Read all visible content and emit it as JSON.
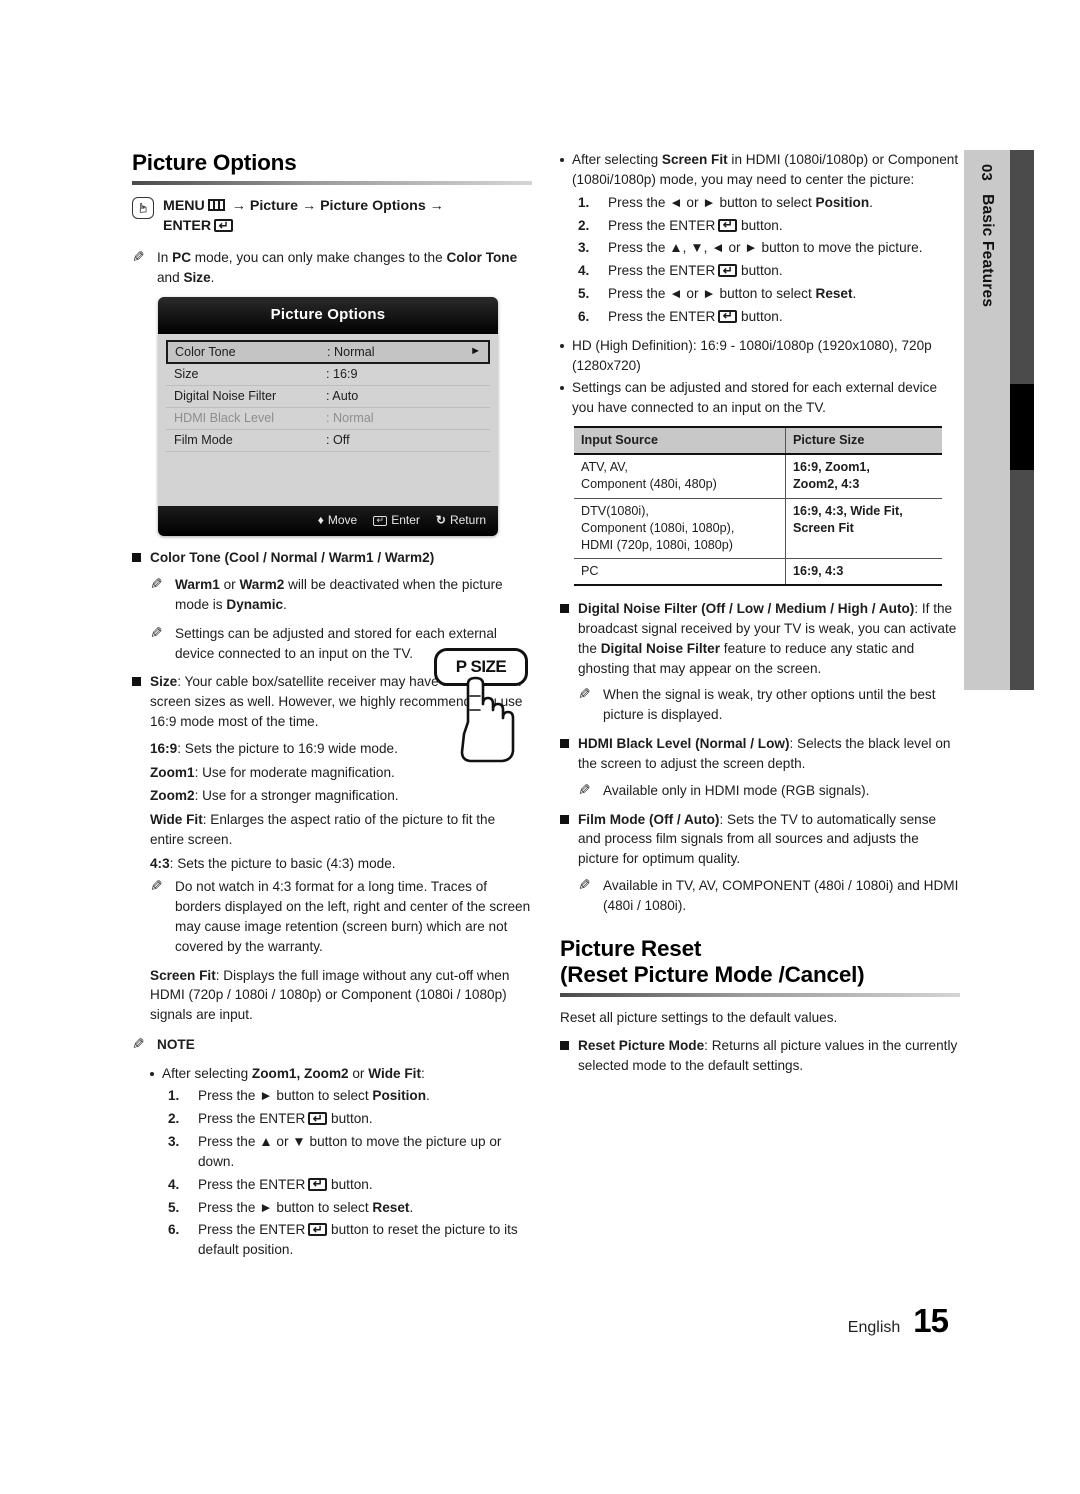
{
  "sidebar": {
    "chapter_number": "03",
    "chapter_title": "Basic Features"
  },
  "footer": {
    "language": "English",
    "page_number": "15"
  },
  "left_column": {
    "heading": "Picture Options",
    "menu_path": "MENU m → Picture → Picture Options → ENTER E",
    "menu_path_parts": {
      "menu_label": "MENU",
      "arrow1": "→",
      "picture": "Picture",
      "arrow2": "→",
      "picture_options": "Picture Options",
      "arrow3": "→",
      "enter_label": "ENTER"
    },
    "note_pc_mode": "In PC mode, you can only make changes to the Color Tone and Size.",
    "osd": {
      "title": "Picture Options",
      "rows": [
        {
          "label": "Color Tone",
          "value": ": Normal",
          "selected": true,
          "dim": false,
          "arrow": "►"
        },
        {
          "label": "Size",
          "value": ": 16:9",
          "selected": false,
          "dim": false,
          "arrow": ""
        },
        {
          "label": "Digital Noise Filter",
          "value": ": Auto",
          "selected": false,
          "dim": false,
          "arrow": ""
        },
        {
          "label": "HDMI Black Level",
          "value": ": Normal",
          "selected": false,
          "dim": true,
          "arrow": ""
        },
        {
          "label": "Film Mode",
          "value": ": Off",
          "selected": false,
          "dim": false,
          "arrow": ""
        }
      ],
      "footer": {
        "move": "Move",
        "enter": "Enter",
        "return": "Return",
        "move_glyph": "♦",
        "return_glyph": "↻"
      }
    },
    "color_tone_heading": "Color Tone (Cool / Normal / Warm1 / Warm2)",
    "color_tone_note1": "Warm1 or Warm2 will be deactivated when the picture mode is Dynamic.",
    "color_tone_note2": "Settings can be adjusted and stored for each external device connected to an input on the TV.",
    "size_heading": "Size",
    "size_text": ": Your cable box/satellite receiver may have its own set of screen sizes as well. However, we highly recommend you use 16:9 mode most of the time.",
    "psize_button_label": "P SIZE",
    "size_items": [
      {
        "term": "16:9",
        "desc": ": Sets the picture to 16:9 wide mode."
      },
      {
        "term": "Zoom1",
        "desc": ": Use for moderate magnification."
      },
      {
        "term": "Zoom2",
        "desc": ": Use for a stronger magnification."
      },
      {
        "term": "Wide Fit",
        "desc": ": Enlarges the aspect ratio of the picture to fit the entire screen."
      },
      {
        "term": "4:3",
        "desc": ": Sets the picture to basic (4:3) mode."
      }
    ],
    "four_three_note": "Do not watch in 4:3 format for a long time. Traces of borders displayed on the left, right and center of the screen may cause image retention (screen burn) which are not covered by the warranty.",
    "screen_fit_term": "Screen Fit",
    "screen_fit_desc": ": Displays the full image without any cut-off when HDMI (720p / 1080i / 1080p) or Component (1080i / 1080p) signals are input.",
    "note_label": "NOTE",
    "note_intro": "After selecting Zoom1, Zoom2 or Wide Fit:",
    "note_steps": [
      {
        "idx": "1.",
        "text": "Press the ► button to select Position."
      },
      {
        "idx": "2.",
        "text": "Press the ENTER E button."
      },
      {
        "idx": "3.",
        "text": "Press the ▲ or ▼ button to move the picture up or down."
      },
      {
        "idx": "4.",
        "text": "Press the ENTER E button."
      },
      {
        "idx": "5.",
        "text": "Press the ► button to select Reset."
      },
      {
        "idx": "6.",
        "text": "Press the ENTER E button to reset the picture to its default position."
      }
    ]
  },
  "right_column": {
    "screen_fit_bullet": "After selecting Screen Fit in HDMI (1080i/1080p) or Component (1080i/1080p) mode, you may need to center the picture:",
    "screen_fit_steps": [
      {
        "idx": "1.",
        "text": "Press the ◄ or ► button to select Position."
      },
      {
        "idx": "2.",
        "text": "Press the ENTER E button."
      },
      {
        "idx": "3.",
        "text": "Press the ▲, ▼, ◄ or ► button to move the picture."
      },
      {
        "idx": "4.",
        "text": "Press the ENTER E button."
      },
      {
        "idx": "5.",
        "text": "Press the ◄ or ► button to select Reset."
      },
      {
        "idx": "6.",
        "text": "Press the ENTER E button."
      }
    ],
    "hd_bullet": "HD (High Definition): 16:9 - 1080i/1080p (1920x1080), 720p (1280x720)",
    "settings_bullet": "Settings can be adjusted and stored for each external device you have connected to an input on the TV.",
    "table": {
      "headers": [
        "Input Source",
        "Picture Size"
      ],
      "rows": [
        {
          "source": "ATV, AV,\nComponent (480i, 480p)",
          "size": "16:9, Zoom1,\nZoom2, 4:3"
        },
        {
          "source": "DTV(1080i),\nComponent (1080i, 1080p),\nHDMI (720p, 1080i, 1080p)",
          "size": "16:9, 4:3, Wide Fit,\nScreen Fit"
        },
        {
          "source": "PC",
          "size": "16:9, 4:3"
        }
      ]
    },
    "dnf_heading": "Digital Noise Filter (Off / Low / Medium / High / Auto)",
    "dnf_text": ": If the broadcast signal received by your TV is weak, you can activate the Digital Noise Filter feature to reduce any static and ghosting that may appear on the screen.",
    "dnf_note": "When the signal is weak, try other options until the best picture is displayed.",
    "hdmi_black_heading": "HDMI Black Level (Normal / Low)",
    "hdmi_black_text": ": Selects the black level on the screen to adjust the screen depth.",
    "hdmi_black_note": "Available only in HDMI mode (RGB signals).",
    "film_mode_heading": "Film Mode (Off / Auto)",
    "film_mode_text": ": Sets the TV to automatically sense and process film signals from all sources and adjusts the picture for optimum quality.",
    "film_mode_note": "Available in TV, AV, COMPONENT (480i / 1080i) and HDMI (480i / 1080i).",
    "picture_reset_heading_line1": "Picture Reset",
    "picture_reset_heading_line2": "(Reset Picture Mode /Cancel)",
    "picture_reset_intro": "Reset all picture settings to the default values.",
    "reset_picture_mode_term": "Reset Picture Mode",
    "reset_picture_mode_desc": ": Returns all picture values in the currently selected mode to the default settings."
  }
}
